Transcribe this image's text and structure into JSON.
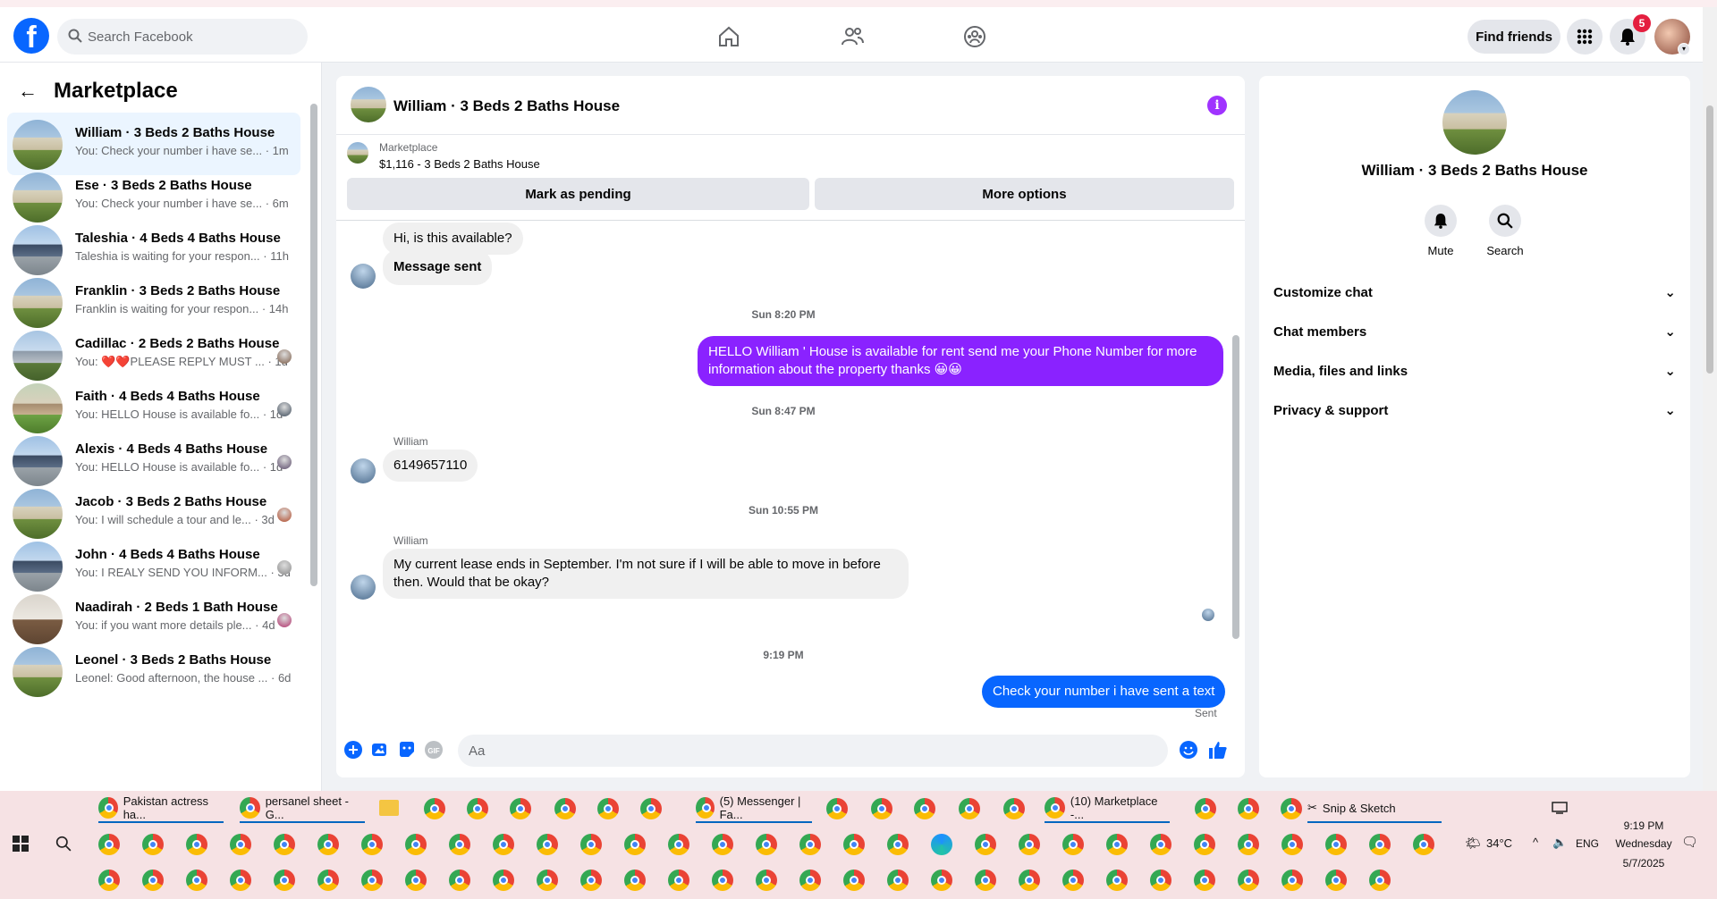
{
  "header": {
    "search_placeholder": "Search Facebook",
    "find_friends": "Find friends",
    "notif_count": "5"
  },
  "sidebar": {
    "title": "Marketplace",
    "conversations": [
      {
        "title": "William · 3 Beds 2 Baths House",
        "preview": "You: Check your number i have se...",
        "time": "· 1m",
        "active": true,
        "house": "a"
      },
      {
        "title": "Ese · 3 Beds 2 Baths House",
        "preview": "You: Check your number i have se...",
        "time": "· 6m",
        "house": "a"
      },
      {
        "title": "Taleshia · 4 Beds 4 Baths House",
        "preview": "Taleshia is waiting for your respon...",
        "time": "· 11h",
        "house": "b"
      },
      {
        "title": "Franklin · 3 Beds 2 Baths House",
        "preview": "Franklin is waiting for your respon...",
        "time": "· 14h",
        "house": "a"
      },
      {
        "title": "Cadillac · 2 Beds 2 Baths House",
        "preview": "You: ❤️❤️PLEASE REPLY MUST ...",
        "time": "· 1d",
        "house": "c"
      },
      {
        "title": "Faith · 4 Beds 4 Baths House",
        "preview": "You: HELLO House is available fo...",
        "time": "· 1d",
        "house": "d"
      },
      {
        "title": "Alexis · 4 Beds 4 Baths House",
        "preview": "You: HELLO House is available fo...",
        "time": "· 1d",
        "house": "b"
      },
      {
        "title": "Jacob · 3 Beds 2 Baths House",
        "preview": "You: I will schedule a tour and le...",
        "time": "· 3d",
        "house": "a"
      },
      {
        "title": "John · 4 Beds 4 Baths House",
        "preview": "You: I REALY SEND YOU INFORM...",
        "time": "· 3d",
        "house": "b"
      },
      {
        "title": "Naadirah · 2 Beds 1 Bath House",
        "preview": "You: if you want more details ple...",
        "time": "· 4d",
        "house": "e"
      },
      {
        "title": "Leonel · 3 Beds 2 Baths House",
        "preview": "Leonel: Good afternoon, the house ...",
        "time": "· 6d",
        "house": "a"
      }
    ]
  },
  "chat": {
    "title": "William · 3 Beds 2 Baths House",
    "marketplace_label": "Marketplace",
    "listing": "$1,116 - 3 Beds 2 Baths House",
    "mark_pending": "Mark as pending",
    "more_options": "More options",
    "msg1": "Hi, is this available?",
    "msg2": "Message sent",
    "ts1": "Sun 8:20 PM",
    "msg3": "HELLO  William ' House is available for rent send me your Phone Number for more information about the property thanks 😀😀",
    "ts2": "Sun 8:47 PM",
    "sender1": "William",
    "msg4": "6149657110",
    "ts3": "Sun 10:55 PM",
    "sender2": "William",
    "msg5": "My current lease ends in September. I'm not sure if I will be able to move in before then. Would that be okay?",
    "ts4": "9:19 PM",
    "msg6": "Check your number i have sent a text",
    "sent_label": "Sent",
    "composer_placeholder": "Aa"
  },
  "panel": {
    "title": "William · 3 Beds 2 Baths House",
    "mute": "Mute",
    "search": "Search",
    "rows": [
      "Customize chat",
      "Chat members",
      "Media, files and links",
      "Privacy & support"
    ]
  },
  "taskbar": {
    "tasks": [
      "Pakistan actress ha...",
      "persanel sheet - G...",
      "(5) Messenger | Fa...",
      "(10) Marketplace -...",
      "Snip & Sketch"
    ],
    "temp": "34°C",
    "lang": "ENG",
    "time": "9:19 PM",
    "day": "Wednesday",
    "date": "5/7/2025"
  },
  "colors": {
    "fb_blue": "#0866ff",
    "purple": "#8a22ff",
    "info": "#a033ff",
    "badge": "#e41e3f"
  }
}
